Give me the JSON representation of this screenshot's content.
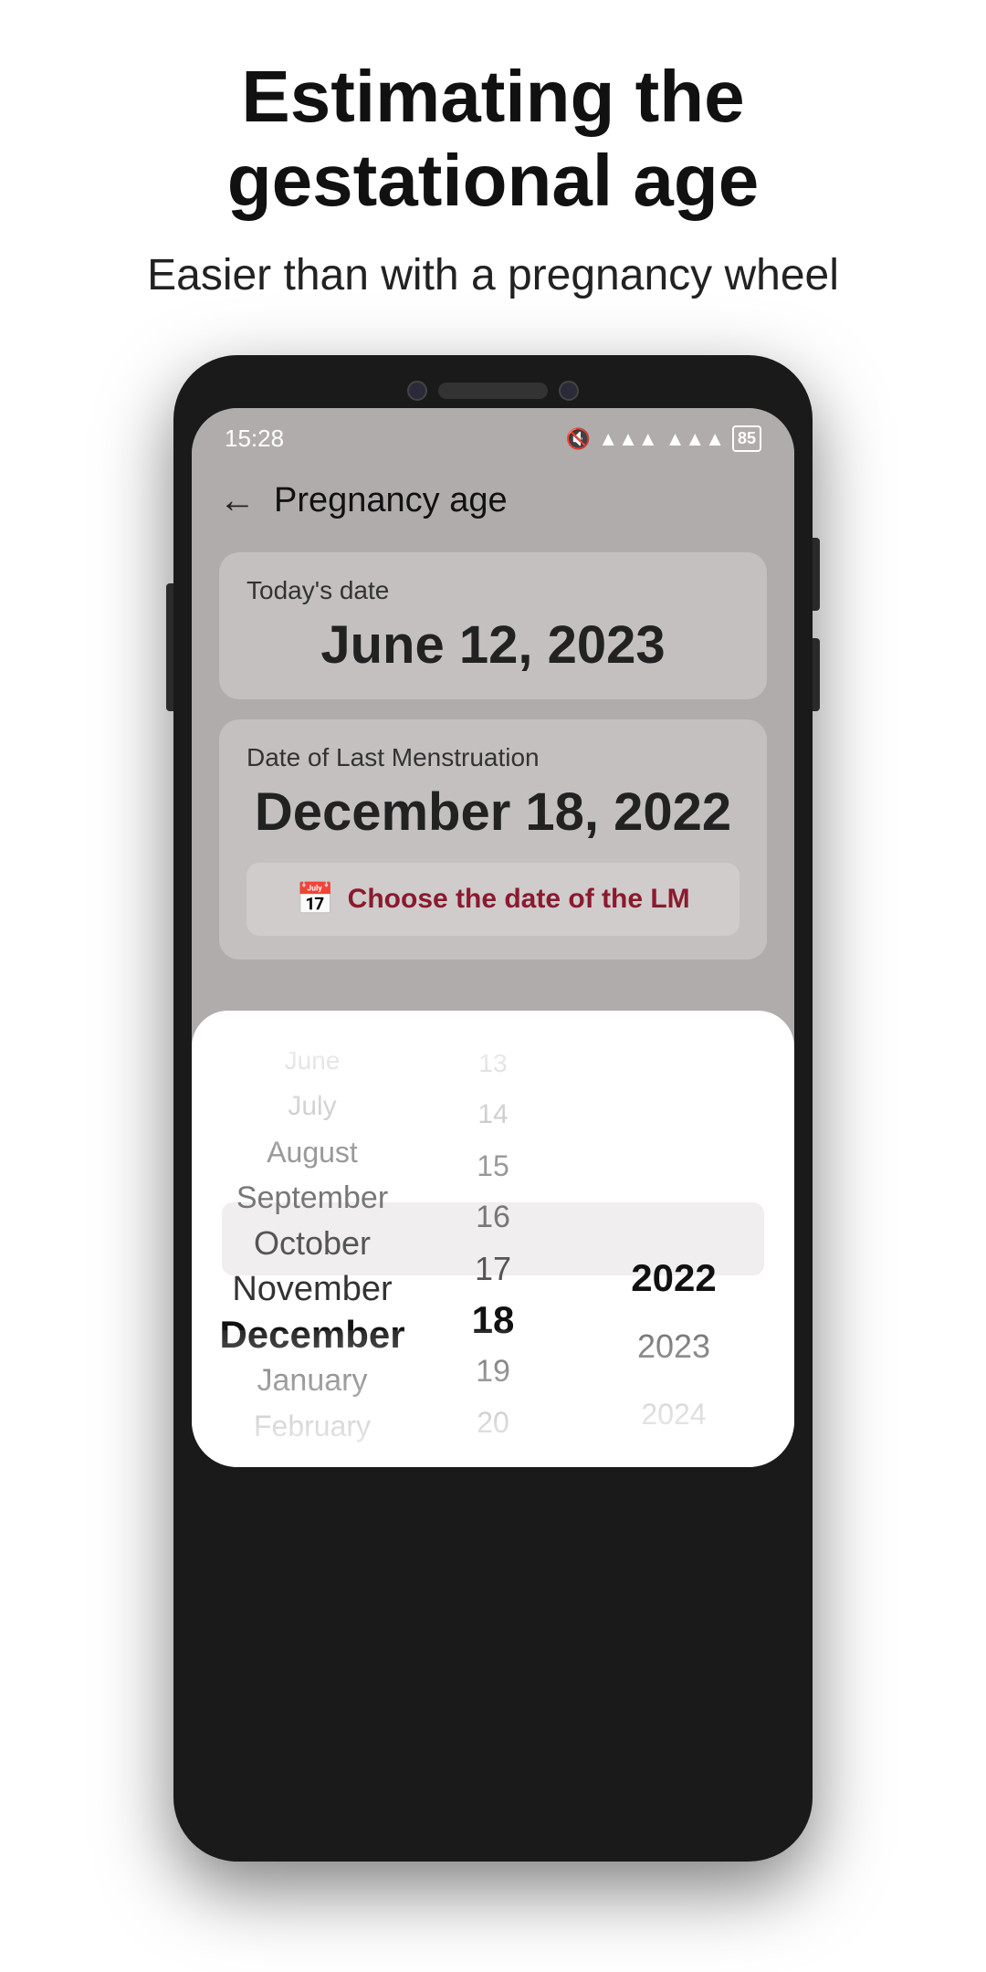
{
  "header": {
    "title": "Estimating the gestational age",
    "subtitle": "Easier than with a pregnancy wheel"
  },
  "statusBar": {
    "time": "15:28",
    "battery": "85"
  },
  "appBar": {
    "backLabel": "←",
    "title": "Pregnancy age"
  },
  "todayCard": {
    "label": "Today's date",
    "value": "June 12, 2023"
  },
  "lmCard": {
    "label": "Date of Last Menstruation",
    "value": "December 18, 2022",
    "buttonText": "Choose the date of the LM"
  },
  "picker": {
    "months": [
      "June",
      "July",
      "August",
      "September",
      "October",
      "November",
      "December",
      "January",
      "February"
    ],
    "monthStates": [
      "faded",
      "faded",
      "faded",
      "faded",
      "normal",
      "normal",
      "selected",
      "normal",
      "normal"
    ],
    "days": [
      "13",
      "14",
      "15",
      "16",
      "17",
      "18",
      "19",
      "20"
    ],
    "dayStates": [
      "faded",
      "faded",
      "faded",
      "faded",
      "normal",
      "selected",
      "normal",
      "normal"
    ],
    "years": [
      "2022",
      "2023",
      "2024"
    ],
    "yearStates": [
      "selected",
      "normal",
      "normal"
    ]
  }
}
